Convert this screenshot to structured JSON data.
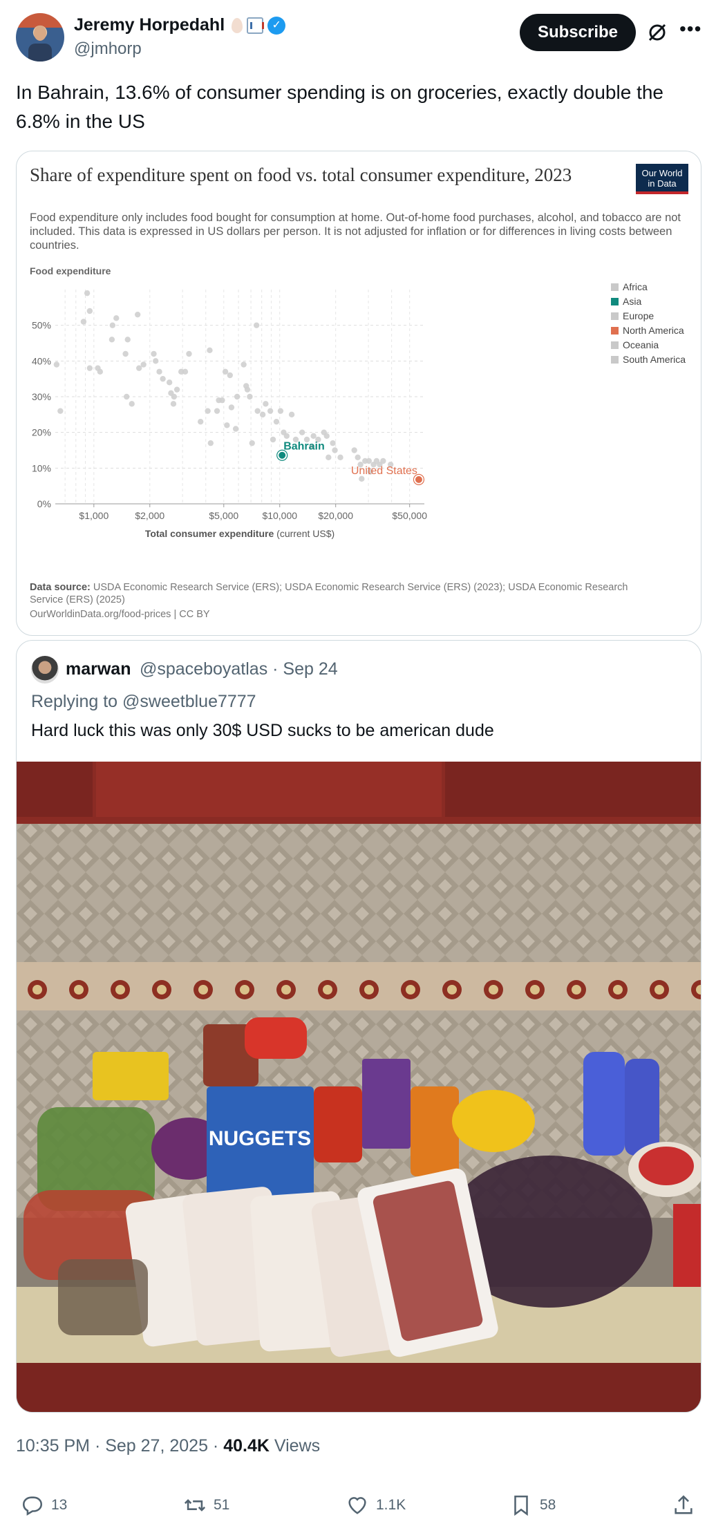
{
  "author": {
    "name": "Jeremy Horpedahl",
    "handle": "@jmhorp",
    "verified_icon": "verified-badge-icon"
  },
  "header": {
    "subscribe_label": "Subscribe"
  },
  "tweet": {
    "text": "In Bahrain, 13.6% of consumer spending is on groceries, exactly double the 6.8% in the US",
    "timestamp": "10:35 PM · Sep 27, 2025 · ",
    "views_count": "40.4K",
    "views_label": "Views"
  },
  "chart_card": {
    "title": "Share of expenditure spent on food vs. total consumer expenditure, 2023",
    "subtitle": "Food expenditure only includes food bought for consumption at home. Out-of-home food purchases, alcohol, and tobacco are not included. This data is expressed in US dollars per person. It is not adjusted for inflation or for differences in living costs between countries.",
    "logo_text_1": "Our World",
    "logo_text_2": "in Data",
    "source_label": "Data source:",
    "source_text": "USDA Economic Research Service (ERS); USDA Economic Research Service (ERS) (2023); USDA Economic Research Service (ERS) (2025)",
    "url_text": "OurWorldinData.org/food-prices | CC BY"
  },
  "chart_data": {
    "type": "scatter",
    "title": "Share of expenditure spent on food vs. total consumer expenditure, 2023",
    "ylabel": "Food expenditure",
    "xlabel_bold": "Total consumer expenditure",
    "xlabel_rest": " (current US$)",
    "x_scale": "log",
    "xlim": [
      620,
      60000
    ],
    "ylim": [
      0,
      60
    ],
    "x_ticks": [
      {
        "value": 1000,
        "label": "$1,000"
      },
      {
        "value": 2000,
        "label": "$2,000"
      },
      {
        "value": 5000,
        "label": "$5,000"
      },
      {
        "value": 10000,
        "label": "$10,000"
      },
      {
        "value": 20000,
        "label": "$20,000"
      },
      {
        "value": 50000,
        "label": "$50,000"
      }
    ],
    "y_ticks": [
      {
        "value": 0,
        "label": "0%"
      },
      {
        "value": 10,
        "label": "10%"
      },
      {
        "value": 20,
        "label": "20%"
      },
      {
        "value": 30,
        "label": "30%"
      },
      {
        "value": 40,
        "label": "40%"
      },
      {
        "value": 50,
        "label": "50%"
      }
    ],
    "grid": true,
    "legend_position": "right",
    "legend": [
      {
        "name": "Africa",
        "color": "#c9c9c9"
      },
      {
        "name": "Asia",
        "color": "#108a7e"
      },
      {
        "name": "Europe",
        "color": "#c9c9c9"
      },
      {
        "name": "North America",
        "color": "#e0704f"
      },
      {
        "name": "Oceania",
        "color": "#c9c9c9"
      },
      {
        "name": "South America",
        "color": "#c9c9c9"
      }
    ],
    "highlighted": [
      {
        "name": "Bahrain",
        "x": 10300,
        "y": 13.6,
        "color": "#108a7e"
      },
      {
        "name": "United States",
        "x": 56000,
        "y": 6.8,
        "color": "#e0704f"
      }
    ],
    "points": [
      [
        630,
        39
      ],
      [
        660,
        26
      ],
      [
        880,
        51
      ],
      [
        920,
        59
      ],
      [
        950,
        54
      ],
      [
        950,
        38
      ],
      [
        1050,
        38
      ],
      [
        1080,
        37
      ],
      [
        1250,
        46
      ],
      [
        1260,
        50
      ],
      [
        1320,
        52
      ],
      [
        1480,
        42
      ],
      [
        1520,
        46
      ],
      [
        1500,
        30
      ],
      [
        1600,
        28
      ],
      [
        1720,
        53
      ],
      [
        1750,
        38
      ],
      [
        1850,
        39
      ],
      [
        2100,
        42
      ],
      [
        2150,
        40
      ],
      [
        2250,
        37
      ],
      [
        2350,
        35
      ],
      [
        2550,
        34
      ],
      [
        2600,
        31
      ],
      [
        2700,
        30
      ],
      [
        2680,
        28
      ],
      [
        2800,
        32
      ],
      [
        2950,
        37
      ],
      [
        3100,
        37
      ],
      [
        3250,
        42
      ],
      [
        3750,
        23
      ],
      [
        4100,
        26
      ],
      [
        4200,
        43
      ],
      [
        4250,
        17
      ],
      [
        4600,
        26
      ],
      [
        4700,
        29
      ],
      [
        4900,
        29
      ],
      [
        5100,
        37
      ],
      [
        5200,
        22
      ],
      [
        5400,
        36
      ],
      [
        5500,
        27
      ],
      [
        5800,
        21
      ],
      [
        5900,
        30
      ],
      [
        6400,
        39
      ],
      [
        6600,
        33
      ],
      [
        6700,
        32
      ],
      [
        6900,
        30
      ],
      [
        7100,
        17
      ],
      [
        7500,
        50
      ],
      [
        7600,
        26
      ],
      [
        8100,
        25
      ],
      [
        8400,
        28
      ],
      [
        8900,
        26
      ],
      [
        9200,
        18
      ],
      [
        9600,
        23
      ],
      [
        10100,
        26
      ],
      [
        10500,
        20
      ],
      [
        10900,
        19
      ],
      [
        11600,
        25
      ],
      [
        12200,
        18
      ],
      [
        13200,
        20
      ],
      [
        14000,
        18
      ],
      [
        14900,
        16
      ],
      [
        15200,
        19
      ],
      [
        16100,
        18
      ],
      [
        17300,
        20
      ],
      [
        17900,
        19
      ],
      [
        18300,
        13
      ],
      [
        19300,
        17
      ],
      [
        19800,
        15
      ],
      [
        21200,
        13
      ],
      [
        25200,
        15
      ],
      [
        26300,
        13
      ],
      [
        27200,
        11
      ],
      [
        27600,
        7
      ],
      [
        28800,
        12
      ],
      [
        30200,
        12
      ],
      [
        30700,
        9
      ],
      [
        32000,
        11
      ],
      [
        33200,
        12
      ],
      [
        34500,
        11
      ],
      [
        36000,
        12
      ],
      [
        39500,
        11
      ]
    ]
  },
  "quote": {
    "name": "marwan",
    "meta": "@spaceboyatlas · Sep 24",
    "reply": "Replying to @sweetblue7777",
    "text": "Hard luck this was only 30$ USD sucks to be american dude",
    "photo_text": "NUGGETS"
  },
  "actions": {
    "reply_count": "13",
    "repost_count": "51",
    "like_count": "1.1K",
    "bookmark_count": "58"
  }
}
